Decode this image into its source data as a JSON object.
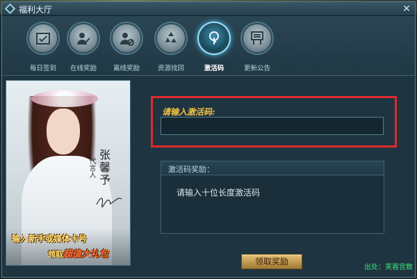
{
  "window": {
    "title": "福利大厅"
  },
  "tabs": [
    {
      "label": "每日签到",
      "icon": "calendar-check-icon",
      "active": false
    },
    {
      "label": "在线奖励",
      "icon": "user-edit-icon",
      "active": false
    },
    {
      "label": "离线奖励",
      "icon": "user-offline-icon",
      "active": false
    },
    {
      "label": "资源找回",
      "icon": "recycle-icon",
      "active": false
    },
    {
      "label": "激活码",
      "icon": "key-icon",
      "active": true
    },
    {
      "label": "更新公告",
      "icon": "notice-board-icon",
      "active": false
    }
  ],
  "promo": {
    "spokesperson_role": "代言人",
    "spokesperson_name": "张馨予",
    "caption_line1": "输入新手或媒体卡号",
    "caption_line2_prefix": "领取",
    "caption_line2_highlight": "超值大礼包"
  },
  "activation": {
    "label": "请输入激活码:",
    "input_value": ""
  },
  "reward": {
    "title": "激活码奖励：",
    "text": "请输入十位长度激活码"
  },
  "claim_button": "领取奖励",
  "footer_note": "出处：芙蓉宫数",
  "colors": {
    "highlight_border": "#e02a2a",
    "label_gold": "#f3c242",
    "active_tab_glow": "#4fc3ec"
  }
}
